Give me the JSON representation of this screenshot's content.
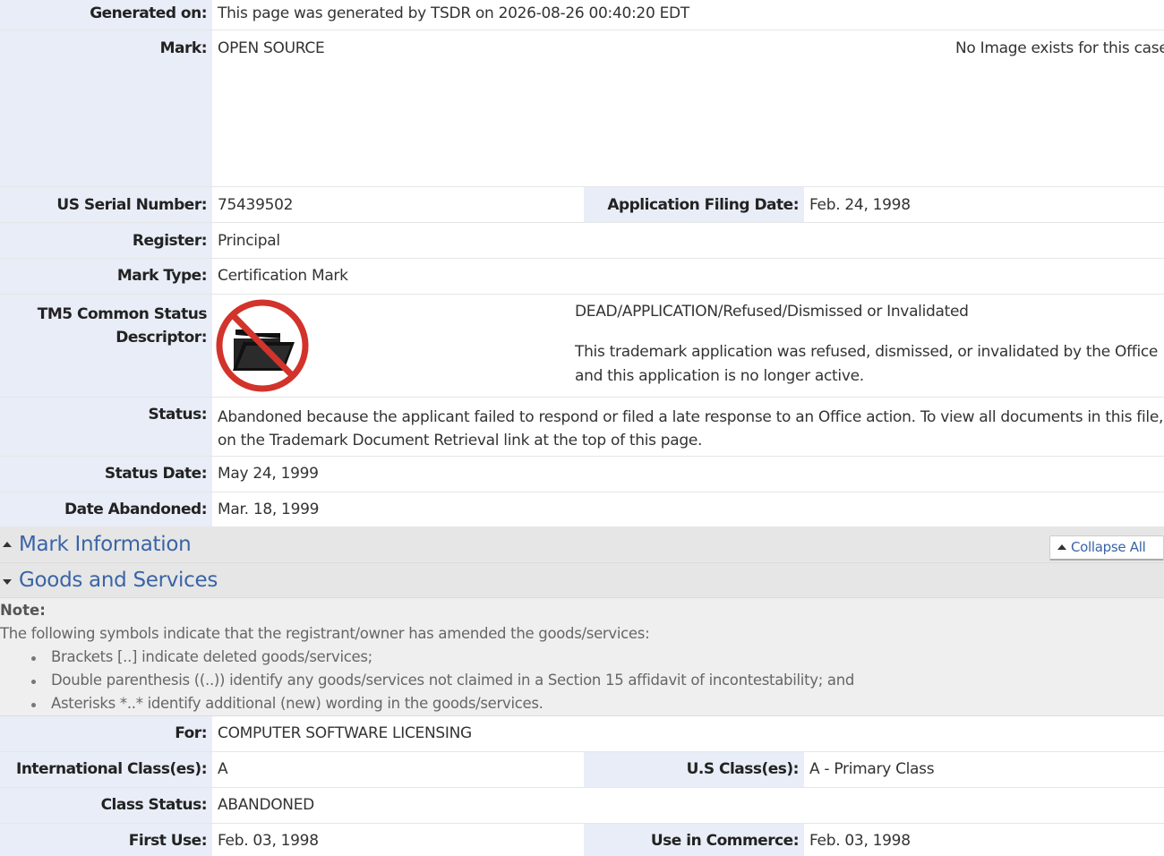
{
  "rows": {
    "generated": {
      "label": "Generated on:",
      "value": "This page was generated by TSDR on 2026-08-26 00:40:20 EDT"
    },
    "mark": {
      "label": "Mark:",
      "value": "OPEN SOURCE",
      "no_image": "No Image exists for this case"
    },
    "serial": {
      "label": "US Serial Number:",
      "value": "75439502",
      "label2": "Application Filing Date:",
      "value2": "Feb. 24, 1998"
    },
    "register": {
      "label": "Register:",
      "value": "Principal"
    },
    "mark_type": {
      "label": "Mark Type:",
      "value": "Certification Mark"
    },
    "tm5": {
      "label_line1": "TM5 Common Status",
      "label_line2": "Descriptor:",
      "status_title": "DEAD/APPLICATION/Refused/Dismissed or Invalidated",
      "status_desc_line1": "This trademark application was refused, dismissed, or invalidated by the Office",
      "status_desc_line2": "and this application is no longer active."
    },
    "status": {
      "label": "Status:",
      "value_line1": "Abandoned because the applicant failed to respond or filed a late response to an Office action. To view all documents in this file, click",
      "value_line2": "on the Trademark Document Retrieval link at the top of this page."
    },
    "status_date": {
      "label": "Status Date:",
      "value": "May 24, 1999"
    },
    "date_abandoned": {
      "label": "Date Abandoned:",
      "value": "Mar. 18, 1999"
    }
  },
  "sections": {
    "mark_info": "Mark Information",
    "collapse_all": "Collapse All",
    "goods": "Goods and Services"
  },
  "note": {
    "heading": "Note:",
    "intro": "The following symbols indicate that the registrant/owner has amended the goods/services:",
    "items": [
      "Brackets [..] indicate deleted goods/services;",
      "Double parenthesis ((..)) identify any goods/services not claimed in a Section 15 affidavit of incontestability; and",
      "Asterisks *..* identify additional (new) wording in the goods/services."
    ]
  },
  "goods": {
    "for": {
      "label": "For:",
      "value": "COMPUTER SOFTWARE LICENSING"
    },
    "class": {
      "label": "International Class(es):",
      "value": "A",
      "label2": "U.S Class(es):",
      "value2": "A - Primary Class"
    },
    "class_status": {
      "label": "Class Status:",
      "value": "ABANDONED"
    },
    "first_use": {
      "label": "First Use:",
      "value": "Feb. 03, 1998",
      "label2": "Use in Commerce:",
      "value2": "Feb. 03, 1998"
    }
  },
  "icons": {
    "status_icon": "dead-application-folder-icon"
  },
  "colors": {
    "label_bg": "#e8edf7",
    "section_title": "#3a64a6",
    "dead_red": "#d2332b"
  }
}
